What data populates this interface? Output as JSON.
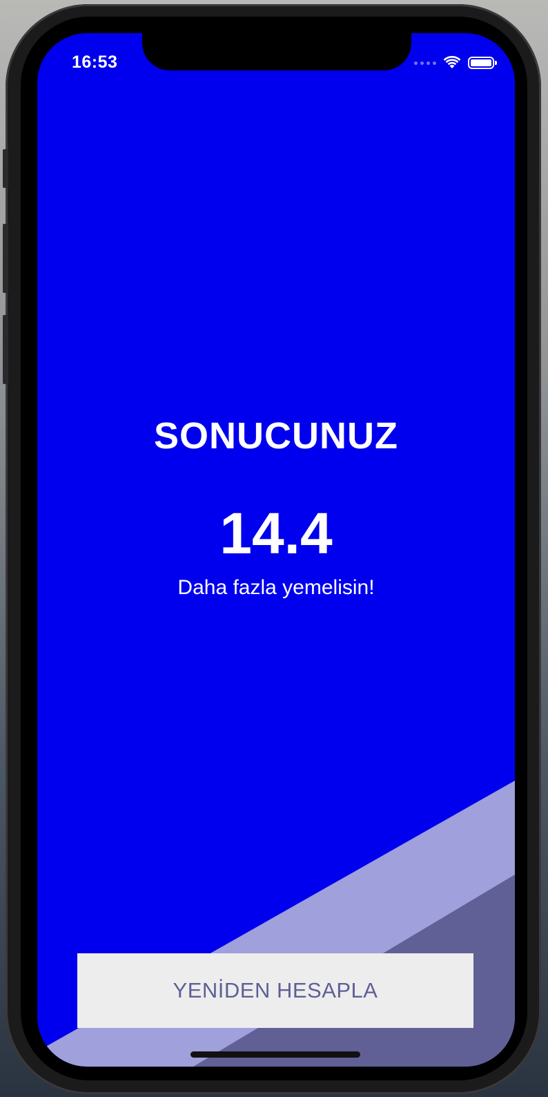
{
  "status_bar": {
    "time": "16:53",
    "icons": [
      "cellular-signal-icon",
      "wifi-icon",
      "battery-icon"
    ]
  },
  "result": {
    "title": "SONUCUNUZ",
    "value": "14.4",
    "message": "Daha fazla yemelisin!"
  },
  "actions": {
    "recalculate_label": "YENİDEN HESAPLA"
  },
  "colors": {
    "background": "#0000EE",
    "stripe_light": "#A0A0DC",
    "stripe_dark": "#606096",
    "button_background": "#EDEDEE",
    "button_text": "#5F5F95",
    "text": "#FFFFFF"
  }
}
